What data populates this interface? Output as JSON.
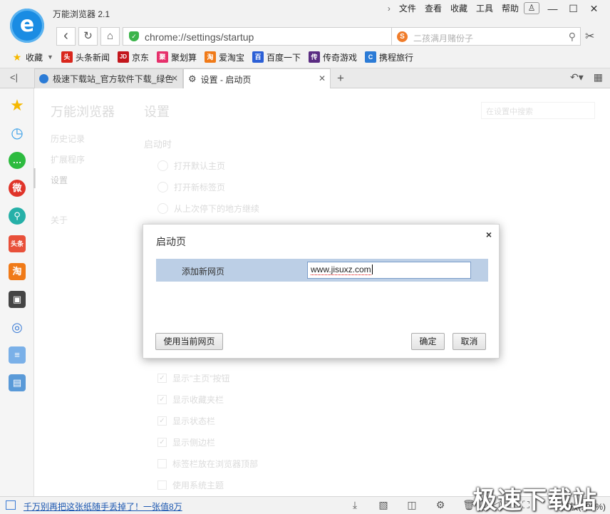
{
  "app": {
    "title": "万能浏览器 2.1",
    "logo_glyph": "e"
  },
  "top_menu": [
    "文件",
    "查看",
    "收藏",
    "工具",
    "帮助"
  ],
  "window_controls": {
    "user": "♙",
    "minimize": "—",
    "maximize": "☐",
    "close": "✕"
  },
  "nav": {
    "back": "‹",
    "refresh": "↻",
    "home": "⌂"
  },
  "address": {
    "url": "chrome://settings/startup",
    "star": "☆",
    "flash": "ϟ",
    "dropdown": "⌄"
  },
  "search": {
    "engine_glyph": "S",
    "placeholder": "二孩满月赌份子",
    "search_glyph": "⚲"
  },
  "bookmarks": [
    {
      "label": "收藏",
      "color": "#f5b800",
      "glyph": "★"
    },
    {
      "label": "头条新闻",
      "color": "#d9261c",
      "glyph": "头"
    },
    {
      "label": "京东",
      "color": "#c3161c",
      "glyph": "JD"
    },
    {
      "label": "聚划算",
      "color": "#e6306b",
      "glyph": "聚"
    },
    {
      "label": "爱淘宝",
      "color": "#f07a18",
      "glyph": "淘"
    },
    {
      "label": "百度一下",
      "color": "#2b5fd6",
      "glyph": "百"
    },
    {
      "label": "传奇游戏",
      "color": "#5a2c82",
      "glyph": "传"
    },
    {
      "label": "携程旅行",
      "color": "#2b7bd6",
      "glyph": "C"
    }
  ],
  "tabs": [
    {
      "title": "极速下载站_官方软件下载_绿色",
      "active": false
    },
    {
      "title": "设置 - 启动页",
      "active": true
    }
  ],
  "settings_page": {
    "brand": "万能浏览器",
    "nav": {
      "history": "历史记录",
      "extensions": "扩展程序",
      "settings": "设置",
      "about": "关于"
    },
    "title": "设置",
    "search_placeholder": "在设置中搜索",
    "startup": {
      "heading": "启动时",
      "options": [
        "打开默认主页",
        "打开新标签页",
        "从上次停下的地方继续"
      ]
    },
    "appearance": [
      {
        "label": "显示\"主页\"按钮",
        "checked": true
      },
      {
        "label": "显示收藏夹栏",
        "checked": true
      },
      {
        "label": "显示状态栏",
        "checked": true
      },
      {
        "label": "显示侧边栏",
        "checked": true
      },
      {
        "label": "标签栏放在浏览器顶部",
        "checked": false
      },
      {
        "label": "使用系统主题",
        "checked": false
      }
    ]
  },
  "dialog": {
    "title": "启动页",
    "close": "×",
    "row_label": "添加新网页",
    "input_value": "www.jisuxz.com",
    "btn_use_current": "使用当前网页",
    "btn_ok": "确定",
    "btn_cancel": "取消"
  },
  "status": {
    "news": "千万别再把这张纸随手丢掉了！一张值8万",
    "zoom": "缩放(100%)",
    "watermark": "极速下载站"
  }
}
